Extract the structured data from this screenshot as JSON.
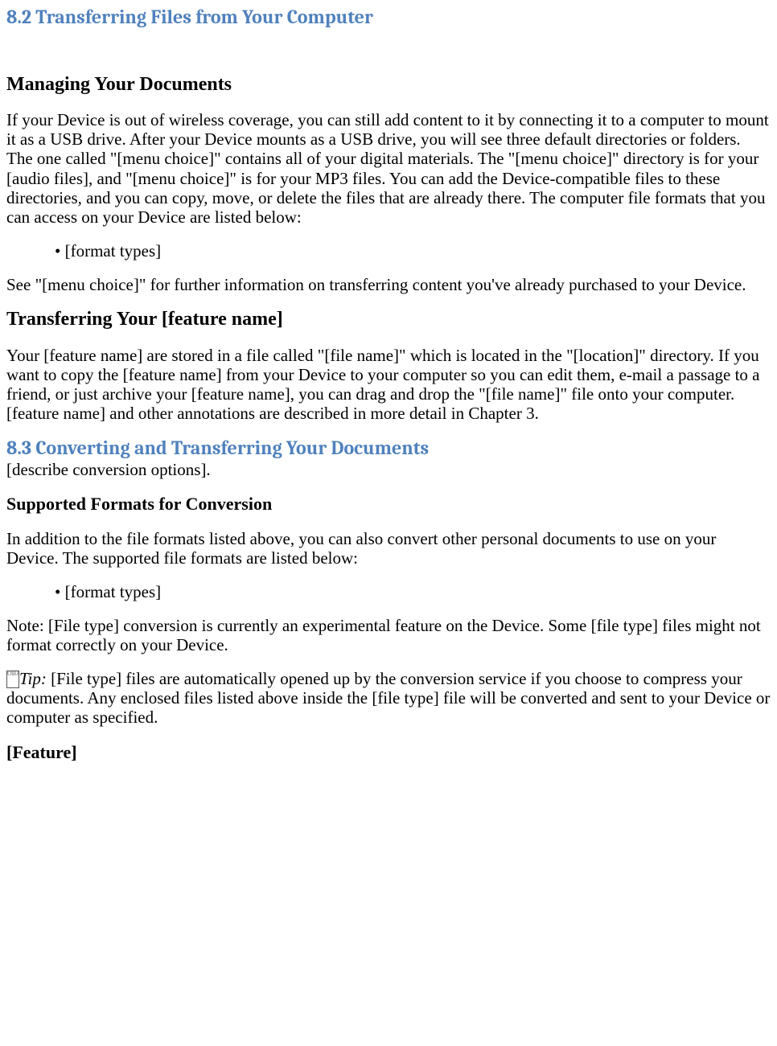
{
  "section82": {
    "heading": "8.2 Transferring Files from Your Computer",
    "managing_heading": "Managing Your Documents",
    "para1": "If your Device is out of wireless coverage, you can still add content to it by connecting it to a computer to mount it as a USB drive. After your Device mounts as a USB drive, you will see three default directories or folders. The one called \"[menu choice]\" contains all of your digital materials. The \"[menu choice]\" directory is for your [audio files], and \"[menu choice]\" is for your MP3 files. You can add the Device-compatible files to these directories, and you can copy, move, or delete the files that are already there. The computer file formats that you can access on your Device are listed below:",
    "bullet1": "• [format types]",
    "para2": "See \"[menu choice]\" for further information on transferring content you've already purchased to your Device.",
    "transferring_heading": "Transferring Your [feature name]",
    "para3": "Your [feature name] are stored in a file called \"[file name]\" which is located in the \"[location]\" directory. If you want to copy the [feature name] from your Device to your computer so you can edit them, e-mail a passage to a friend, or just archive your [feature name], you can drag and drop the \"[file name]\" file onto your computer. [feature name] and other annotations are described in more detail in Chapter 3."
  },
  "section83": {
    "heading": "8.3 Converting and Transferring Your Documents",
    "subline": "[describe conversion options].",
    "supported_heading": "Supported Formats for Conversion",
    "para1": "In addition to the file formats listed above, you can also convert other personal documents to use on your Device. The supported file formats are listed below:",
    "bullet1": "• [format types]",
    "note": "Note: [File type] conversion is currently an experimental feature on the Device. Some [file type] files might not format correctly on your Device.",
    "tip_label": "Tip:",
    "tip_body": " [File type] files are automatically opened up by the conversion service if you choose to compress your documents. Any enclosed files listed above inside the [file type] file will be converted and sent to your Device or computer as specified.",
    "feature_heading": "[Feature]"
  }
}
